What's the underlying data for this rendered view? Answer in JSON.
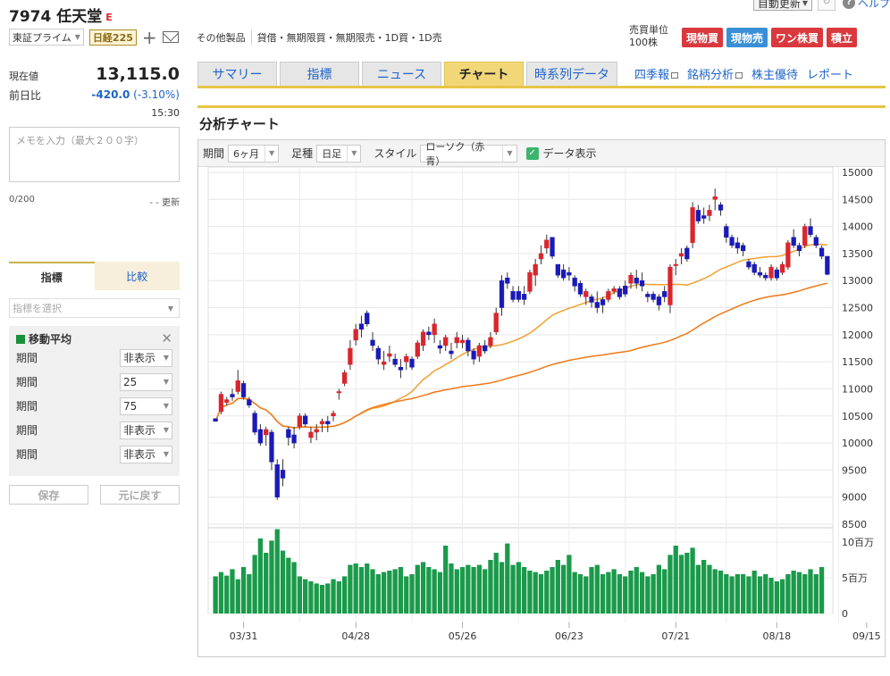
{
  "header": {
    "title": "7974 任天堂",
    "market_mark": "E",
    "auto_update": "自動更新",
    "help": "ヘルプ",
    "exchange": "東証プライム",
    "index_badge": "日経225",
    "sector": "その他製品",
    "margin_info": "貸借・無期限買・無期限売・1D買・1D売",
    "unit_label": "売買単位",
    "unit_value": "100株",
    "buttons": [
      {
        "label": "現物買",
        "color": "#d9393e"
      },
      {
        "label": "現物売",
        "color": "#3a8fd6"
      },
      {
        "label": "ワン株買",
        "color": "#d9393e"
      },
      {
        "label": "積立",
        "color": "#d9393e"
      }
    ]
  },
  "quote": {
    "price_label": "現在値",
    "price": "13,115.0",
    "change_label": "前日比",
    "change": "-420.0",
    "change_pct": "(-3.10%)",
    "time": "15:30"
  },
  "memo": {
    "placeholder": "メモを入力（最大２００字）",
    "count": "0/200",
    "updated": "- - 更新"
  },
  "left_tabs": {
    "active": "指標",
    "other": "比較"
  },
  "indicator": {
    "select_placeholder": "指標を選択",
    "ma_title": "移動平均",
    "rows": [
      {
        "label": "期間",
        "value": "非表示"
      },
      {
        "label": "期間",
        "value": "25"
      },
      {
        "label": "期間",
        "value": "75"
      },
      {
        "label": "期間",
        "value": "非表示"
      },
      {
        "label": "期間",
        "value": "非表示"
      }
    ],
    "save": "保存",
    "reset": "元に戻す"
  },
  "tabs": [
    {
      "label": "サマリー",
      "active": false
    },
    {
      "label": "指標",
      "active": false
    },
    {
      "label": "ニュース",
      "active": false
    },
    {
      "label": "チャート",
      "active": true
    },
    {
      "label": "時系列データ",
      "active": false
    }
  ],
  "links": [
    "四季報",
    "銘柄分析",
    "株主優待",
    "レポート"
  ],
  "section_title": "分析チャート",
  "controls": {
    "period_label": "期間",
    "period_value": "6ヶ月",
    "interval_label": "足種",
    "interval_value": "日足",
    "style_label": "スタイル",
    "style_value": "ローソク（赤青）",
    "data_display": "データ表示"
  },
  "chart_data": {
    "type": "candlestick",
    "y_ticks": [
      "15000",
      "14500",
      "14000",
      "13500",
      "13000",
      "12500",
      "12000",
      "11500",
      "11000",
      "10500",
      "10000",
      "9500",
      "9000",
      "8500"
    ],
    "volume_ticks": [
      "10百万",
      "5百万",
      "0"
    ],
    "x_ticks": [
      "03/31",
      "04/28",
      "05/26",
      "06/23",
      "07/21",
      "08/18",
      "09/15"
    ],
    "ylim": [
      8500,
      15000
    ],
    "volume_max": 10,
    "up_color": "#d9262d",
    "down_color": "#1a1ab8",
    "volume_color": "#1a9a4a",
    "ma25_color": "#f0a030",
    "ma75_color": "#f07818",
    "candles": [
      [
        10450,
        10450,
        10400,
        10400
      ],
      [
        10580,
        10950,
        10530,
        10900
      ],
      [
        10750,
        10850,
        10700,
        10800
      ],
      [
        10900,
        11000,
        10780,
        10850
      ],
      [
        10950,
        11350,
        10900,
        11150
      ],
      [
        11100,
        11150,
        10800,
        10850
      ],
      [
        10800,
        10850,
        10650,
        10700
      ],
      [
        10550,
        10600,
        10150,
        10200
      ],
      [
        10250,
        10350,
        9950,
        10000
      ],
      [
        10150,
        10300,
        9950,
        10250
      ],
      [
        10200,
        10250,
        9500,
        9650
      ],
      [
        9600,
        9700,
        8950,
        9000
      ],
      [
        9500,
        9700,
        9200,
        9350
      ],
      [
        10250,
        10300,
        9950,
        10100
      ],
      [
        10150,
        10300,
        9900,
        10000
      ],
      [
        10300,
        10550,
        10250,
        10500
      ],
      [
        10500,
        10550,
        10300,
        10350
      ],
      [
        10100,
        10300,
        10000,
        10200
      ],
      [
        10200,
        10350,
        10050,
        10250
      ],
      [
        10350,
        10450,
        10200,
        10400
      ],
      [
        10400,
        10500,
        10200,
        10350
      ],
      [
        10500,
        10600,
        10400,
        10550
      ],
      [
        10950,
        11000,
        10800,
        10950
      ],
      [
        11100,
        11350,
        11050,
        11300
      ],
      [
        11450,
        11900,
        11350,
        11750
      ],
      [
        11900,
        12200,
        11800,
        12100
      ],
      [
        12200,
        12350,
        11950,
        12100
      ],
      [
        12400,
        12450,
        12150,
        12200
      ],
      [
        11900,
        12050,
        11700,
        11800
      ],
      [
        11750,
        11800,
        11450,
        11550
      ],
      [
        11450,
        11700,
        11350,
        11500
      ],
      [
        11600,
        11800,
        11500,
        11650
      ],
      [
        11550,
        11650,
        11400,
        11450
      ],
      [
        11400,
        11550,
        11200,
        11350
      ],
      [
        11500,
        11650,
        11350,
        11600
      ],
      [
        11550,
        11600,
        11350,
        11400
      ],
      [
        11600,
        11900,
        11550,
        11850
      ],
      [
        11800,
        12100,
        11700,
        12050
      ],
      [
        12050,
        12150,
        11900,
        12000
      ],
      [
        12000,
        12300,
        11850,
        12200
      ],
      [
        11800,
        11900,
        11650,
        11750
      ],
      [
        11800,
        12000,
        11700,
        11950
      ],
      [
        11700,
        11850,
        11550,
        11650
      ],
      [
        11850,
        12050,
        11750,
        11950
      ],
      [
        11850,
        12000,
        11750,
        11900
      ],
      [
        11900,
        11950,
        11600,
        11700
      ],
      [
        11700,
        11750,
        11450,
        11550
      ],
      [
        11600,
        11850,
        11500,
        11800
      ],
      [
        11800,
        11900,
        11650,
        11700
      ],
      [
        11800,
        12050,
        11750,
        11950
      ],
      [
        12050,
        12500,
        12000,
        12400
      ],
      [
        13000,
        13100,
        12350,
        12500
      ],
      [
        13050,
        13150,
        12850,
        12950
      ],
      [
        12800,
        12900,
        12600,
        12650
      ],
      [
        12800,
        12900,
        12600,
        12650
      ],
      [
        12750,
        12900,
        12550,
        12650
      ],
      [
        12800,
        13200,
        12750,
        13150
      ],
      [
        13100,
        13400,
        12900,
        13300
      ],
      [
        13400,
        13650,
        13300,
        13500
      ],
      [
        13600,
        13850,
        13500,
        13750
      ],
      [
        13800,
        13800,
        13400,
        13450
      ],
      [
        13300,
        13300,
        13050,
        13100
      ],
      [
        13200,
        13300,
        13000,
        13050
      ],
      [
        13150,
        13250,
        13000,
        13100
      ],
      [
        13050,
        13100,
        12800,
        12900
      ],
      [
        12950,
        13000,
        12700,
        12750
      ],
      [
        12700,
        12850,
        12550,
        12800
      ],
      [
        12700,
        12750,
        12500,
        12600
      ],
      [
        12600,
        12800,
        12400,
        12500
      ],
      [
        12650,
        12700,
        12400,
        12550
      ],
      [
        12650,
        12850,
        12600,
        12800
      ],
      [
        12800,
        12900,
        12750,
        12850
      ],
      [
        12850,
        12900,
        12650,
        12700
      ],
      [
        12900,
        13000,
        12700,
        12750
      ],
      [
        12950,
        13150,
        12850,
        13100
      ],
      [
        13050,
        13200,
        12850,
        12950
      ],
      [
        13000,
        13150,
        12800,
        12900
      ],
      [
        12750,
        12800,
        12600,
        12700
      ],
      [
        12750,
        12800,
        12600,
        12650
      ],
      [
        12700,
        12750,
        12450,
        12550
      ],
      [
        12800,
        12900,
        12600,
        12700
      ],
      [
        12550,
        13300,
        12400,
        13250
      ],
      [
        13300,
        13400,
        13100,
        13300
      ],
      [
        13450,
        13600,
        13300,
        13500
      ],
      [
        13600,
        13650,
        13350,
        13400
      ],
      [
        13700,
        14450,
        13600,
        14350
      ],
      [
        14300,
        14400,
        14050,
        14100
      ],
      [
        14200,
        14350,
        14050,
        14150
      ],
      [
        14200,
        14400,
        14100,
        14300
      ],
      [
        14500,
        14700,
        14300,
        14550
      ],
      [
        14400,
        14450,
        14200,
        14300
      ],
      [
        14000,
        14050,
        13700,
        13800
      ],
      [
        13800,
        13850,
        13600,
        13650
      ],
      [
        13700,
        13800,
        13500,
        13600
      ],
      [
        13650,
        13700,
        13450,
        13550
      ],
      [
        13350,
        13400,
        13200,
        13250
      ],
      [
        13300,
        13350,
        13100,
        13150
      ],
      [
        13150,
        13250,
        13050,
        13100
      ],
      [
        13100,
        13150,
        13000,
        13050
      ],
      [
        13050,
        13300,
        13000,
        13250
      ],
      [
        13200,
        13250,
        13000,
        13050
      ],
      [
        13150,
        13350,
        13100,
        13300
      ],
      [
        13250,
        13750,
        13200,
        13700
      ],
      [
        13800,
        13950,
        13600,
        13650
      ],
      [
        13650,
        13700,
        13450,
        13550
      ],
      [
        13650,
        14050,
        13600,
        14000
      ],
      [
        14000,
        14150,
        13800,
        13850
      ],
      [
        13800,
        13850,
        13600,
        13650
      ],
      [
        13600,
        13650,
        13400,
        13450
      ],
      [
        13450,
        13450,
        13100,
        13115
      ]
    ],
    "volumes": [
      5.2,
      5.8,
      5.3,
      6.2,
      4.8,
      6.5,
      5.5,
      8.2,
      10.5,
      8.5,
      10.2,
      11.8,
      8.8,
      7.8,
      7.2,
      5.2,
      4.8,
      4.5,
      4.2,
      4.0,
      4.2,
      4.8,
      4.5,
      5.2,
      6.8,
      7.0,
      6.5,
      7.0,
      6.2,
      5.5,
      5.8,
      6.0,
      6.2,
      6.5,
      5.2,
      5.5,
      6.8,
      7.2,
      6.5,
      6.2,
      5.8,
      9.5,
      7.0,
      6.2,
      6.5,
      6.8,
      6.5,
      6.8,
      6.2,
      7.5,
      8.5,
      7.2,
      9.8,
      6.8,
      7.2,
      6.5,
      6.0,
      5.8,
      5.5,
      6.0,
      6.5,
      7.5,
      6.8,
      8.2,
      5.8,
      5.5,
      5.2,
      6.5,
      6.8,
      5.5,
      5.8,
      6.2,
      5.5,
      5.2,
      6.0,
      6.5,
      5.8,
      5.2,
      5.5,
      6.8,
      6.2,
      8.2,
      9.5,
      8.2,
      8.5,
      9.2,
      6.8,
      7.5,
      6.8,
      6.2,
      6.0,
      5.5,
      5.2,
      5.5,
      5.5,
      5.2,
      6.0,
      5.2,
      5.5,
      5.0,
      4.5,
      4.8,
      5.5,
      6.0,
      5.8,
      5.5,
      6.2,
      5.5,
      6.5
    ]
  }
}
